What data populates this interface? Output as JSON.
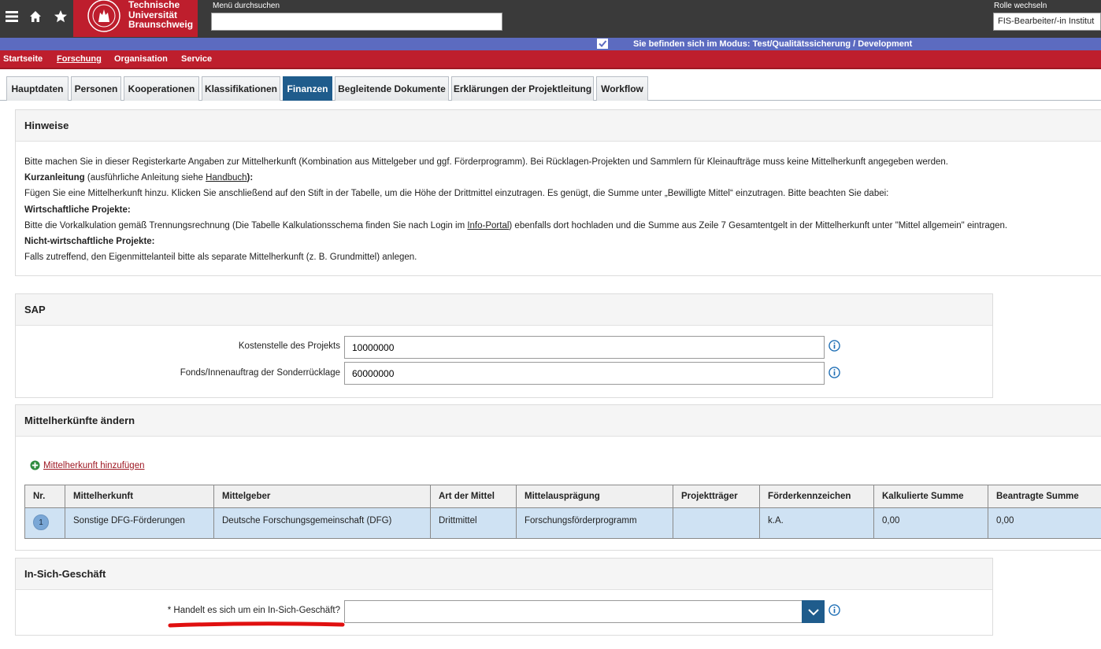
{
  "topbar": {
    "logo_lines": [
      "Technische",
      "Universität",
      "Braunschweig"
    ],
    "search_label": "Menü durchsuchen",
    "search_value": "",
    "role_label": "Rolle wechseln",
    "role_value": "FIS-Bearbeiter/-in Institut"
  },
  "mode_text": "Sie befinden sich im Modus: Test/Qualitätssicherung / Development",
  "nav": [
    "Startseite",
    "Forschung",
    "Organisation",
    "Service"
  ],
  "tabs": [
    "Hauptdaten",
    "Personen",
    "Kooperationen",
    "Klassifikationen",
    "Finanzen",
    "Begleitende Dokumente",
    "Erklärungen der Projektleitung",
    "Workflow"
  ],
  "hinweise": {
    "title": "Hinweise",
    "line1": "Bitte machen Sie in dieser Registerkarte Angaben zur Mittelherkunft (Kombination aus Mittelgeber und ggf. Förderprogramm). Bei Rücklagen-Projekten und Sammlern für Kleinaufträge muss keine Mittelherkunft angegeben werden.",
    "kurz_bold": "Kurzanleitung",
    "kurz_pre": " (ausführliche Anleitung siehe ",
    "kurz_link": "Handbuch",
    "kurz_post": "):",
    "line3": "Fügen Sie eine Mittelherkunft hinzu. Klicken Sie anschließend auf den Stift in der Tabelle, um die Höhe der Drittmittel einzutragen. Es genügt, die Summe unter „Bewilligte Mittel“ einzutragen. Bitte beachten Sie dabei:",
    "wirt_head": "Wirtschaftliche Projekte:",
    "wirt_pre": "Bitte die Vorkalkulation gemäß Trennungsrechnung (Die Tabelle Kalkulationsschema finden Sie nach Login im ",
    "wirt_link": "Info-Portal",
    "wirt_post": ") ebenfalls dort hochladen und die Summe aus Zeile 7 Gesamtentgelt in der Mittelherkunft unter \"Mittel allgemein\" eintragen.",
    "nicht_head": "Nicht-wirtschaftliche Projekte:",
    "nicht_text": "Falls zutreffend, den Eigenmittelanteil bitte als separate Mittelherkunft (z. B. Grundmittel) anlegen."
  },
  "sap": {
    "title": "SAP",
    "kostenstelle_label": "Kostenstelle des Projekts",
    "kostenstelle_value": "10000000",
    "fonds_label": "Fonds/Innenauftrag der Sonderrücklage",
    "fonds_value": "60000000"
  },
  "mittel": {
    "title": "Mittelherkünfte ändern",
    "add_label": "Mittelherkunft hinzufügen",
    "columns": [
      "Nr.",
      "Mittelherkunft",
      "Mittelgeber",
      "Art der Mittel",
      "Mittelausprägung",
      "Projektträger",
      "Förderkennzeichen",
      "Kalkulierte Summe",
      "Beantragte Summe"
    ],
    "rows": [
      [
        "1",
        "Sonstige DFG-Förderungen",
        "Deutsche Forschungsgemeinschaft (DFG)",
        "Drittmittel",
        "Forschungsförderprogramm",
        "",
        "k.A.",
        "0,00",
        "0,00"
      ]
    ]
  },
  "insich": {
    "title": "In-Sich-Geschäft",
    "question": "* Handelt es sich um ein In-Sich-Geschäft?",
    "value": ""
  },
  "colors": {
    "accent_red": "#be1e2d",
    "mode_blue": "#5c6bc0",
    "tab_active": "#1f5c8c",
    "row_blue": "#cfe2f3"
  }
}
